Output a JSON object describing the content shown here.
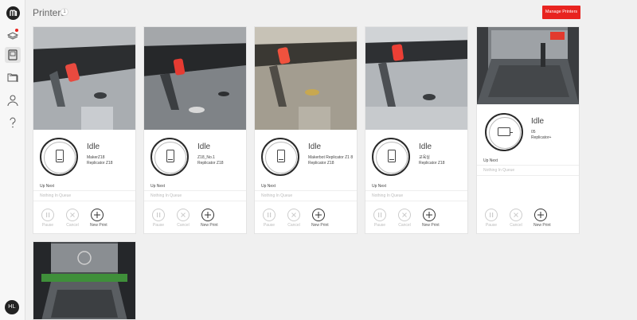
{
  "header": {
    "title": "Printers",
    "count": "1",
    "manage_label": "Manage Printers"
  },
  "sidebar": {
    "items": [
      {
        "name": "logo-icon"
      },
      {
        "name": "add-print-icon"
      },
      {
        "name": "printers-icon"
      },
      {
        "name": "files-icon"
      },
      {
        "name": "account-icon"
      },
      {
        "name": "help-icon"
      }
    ],
    "user_initials": "HL"
  },
  "printers": [
    {
      "status": "Idle",
      "name": "MakerZ18",
      "model": "Replicator Z18",
      "up_next": "Up Next",
      "queue": "Nothing In Queue",
      "pause": "Pause",
      "cancel": "Cancel",
      "new_print": "New Print"
    },
    {
      "status": "Idle",
      "name": "Z18_No.1",
      "model": "Replicator Z18",
      "up_next": "Up Next",
      "queue": "Nothing In Queue",
      "pause": "Pause",
      "cancel": "Cancel",
      "new_print": "New Print"
    },
    {
      "status": "Idle",
      "name": "Makerbot Replicator Z1 8",
      "model": "Replicator Z18",
      "up_next": "Up Next",
      "queue": "Nothing In Queue",
      "pause": "Pause",
      "cancel": "Cancel",
      "new_print": "New Print"
    },
    {
      "status": "Idle",
      "name": "교육실",
      "model": "Replicator Z18",
      "up_next": "Up Next",
      "queue": "Nothing In Queue",
      "pause": "Pause",
      "cancel": "Cancel",
      "new_print": "New Print"
    },
    {
      "status": "Idle",
      "name": "05",
      "model": "Replicator+",
      "up_next": "Up Next",
      "queue": "Nothing In Queue",
      "pause": "Pause",
      "cancel": "Cancel",
      "new_print": "New Print"
    }
  ],
  "colors": {
    "accent": "#e8231f",
    "background": "#f0f0f0",
    "card": "#ffffff"
  }
}
